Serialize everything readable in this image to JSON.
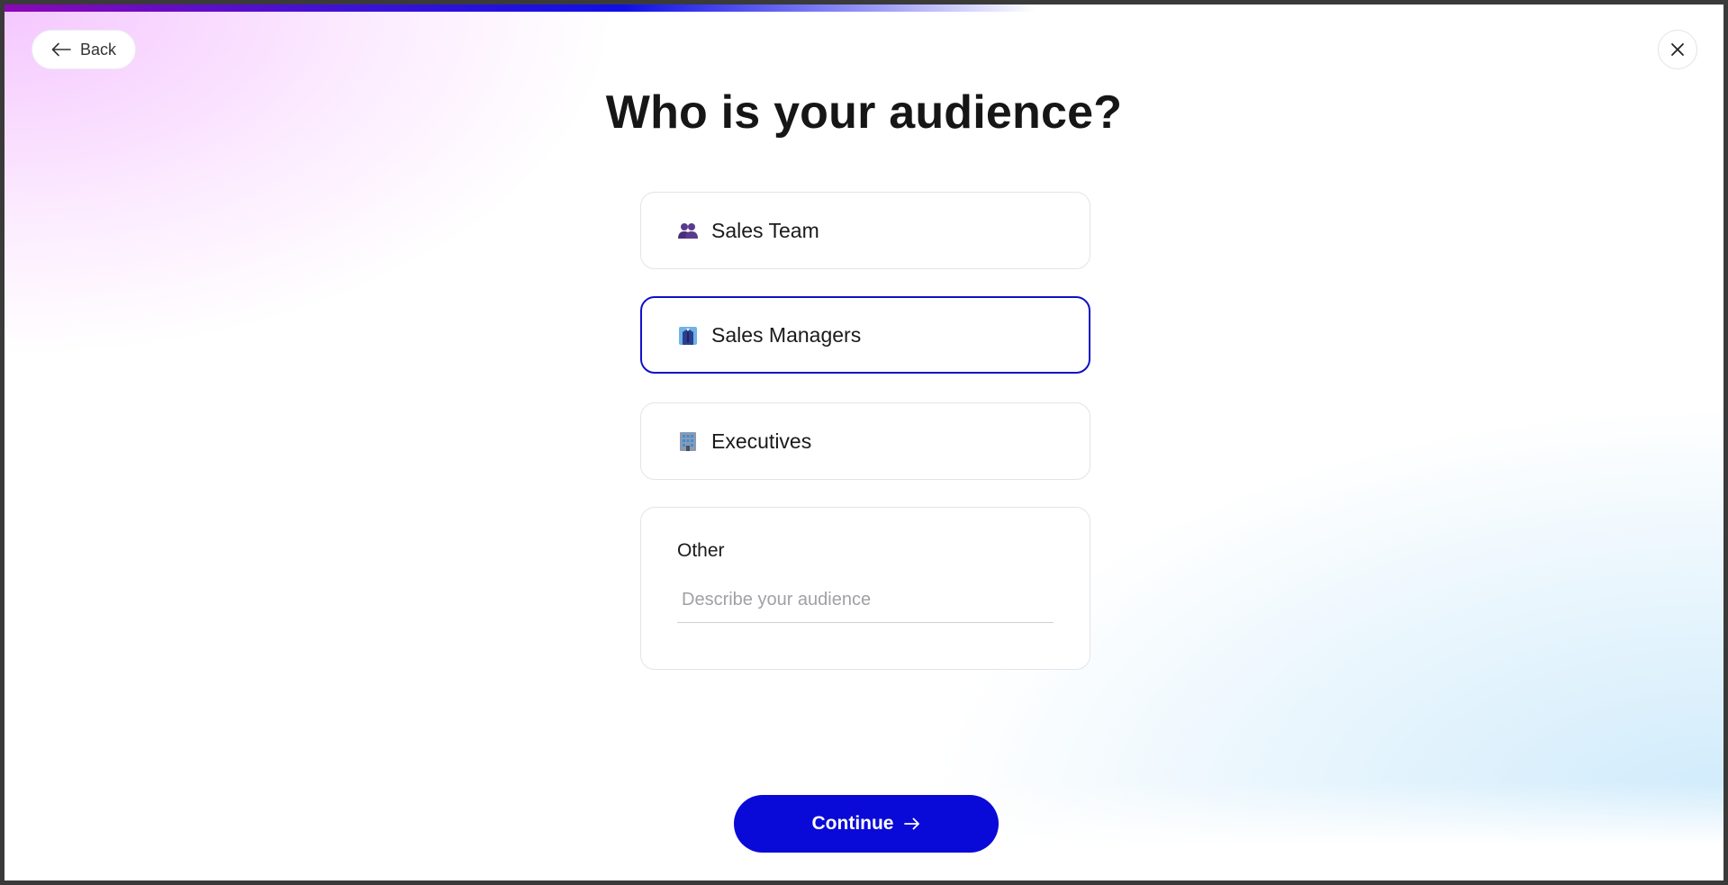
{
  "progress": {
    "fraction": 0.6
  },
  "nav": {
    "back_label": "Back",
    "back_icon": "arrow-left-icon",
    "close_icon": "close-icon"
  },
  "page": {
    "title": "Who is your audience?"
  },
  "options": [
    {
      "label": "Sales Team",
      "icon": "people-icon",
      "selected": false
    },
    {
      "label": "Sales Managers",
      "icon": "businessperson-icon",
      "selected": true
    },
    {
      "label": "Executives",
      "icon": "office-building-icon",
      "selected": false
    }
  ],
  "other": {
    "label": "Other",
    "placeholder": "Describe your audience",
    "value": ""
  },
  "continue": {
    "label": "Continue",
    "icon": "arrow-right-icon"
  },
  "colors": {
    "accent": "#0a0ad8",
    "selected_border": "#1010c8",
    "title": "#161616"
  }
}
